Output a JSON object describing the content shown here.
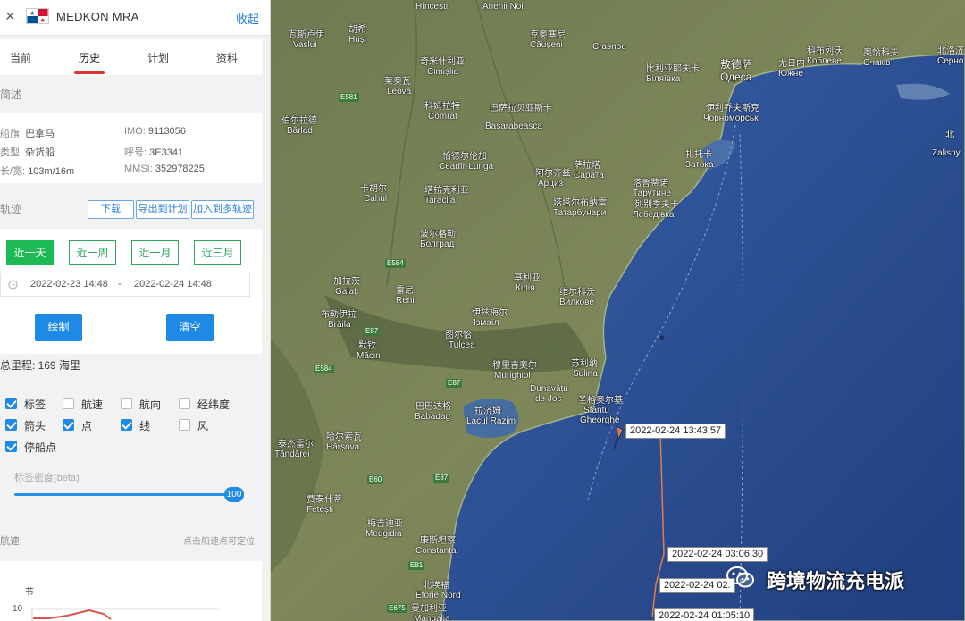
{
  "header": {
    "close_symbol": "×",
    "ship_name": "MEDKON MRA",
    "collapse_label": "收起",
    "flag_colors": [
      "#ffffff",
      "#d21034",
      "#005293"
    ]
  },
  "tabs": [
    {
      "label": "当前",
      "active": false
    },
    {
      "label": "历史",
      "active": true
    },
    {
      "label": "计划",
      "active": false
    },
    {
      "label": "资料",
      "active": false
    }
  ],
  "sections": {
    "basic": "简述",
    "track": "轨迹",
    "speed": "航速"
  },
  "basic_info": {
    "flag_key": "船旗:",
    "flag_value": "巴拿马",
    "type_key": "类型:",
    "type_value": "杂货船",
    "size_key": "长/宽:",
    "size_value": "103m/16m",
    "imo_key": "IMO:",
    "imo_value": "9113056",
    "callsign_key": "呼号:",
    "callsign_value": "3E3341",
    "mmsi_key": "MMSI:",
    "mmsi_value": "352978225"
  },
  "track_actions": {
    "download": "下载",
    "export_plan": "导出到计划",
    "add_multi": "加入到多轨迹"
  },
  "ranges": [
    {
      "label": "近一天",
      "active": true
    },
    {
      "label": "近一周",
      "active": false
    },
    {
      "label": "近一月",
      "active": false
    },
    {
      "label": "近三月",
      "active": false
    }
  ],
  "date_range": {
    "start": "2022-02-23 14:48",
    "separator": "-",
    "end": "2022-02-24 14:48"
  },
  "actions": {
    "draw": "绘制",
    "clear": "清空"
  },
  "total_distance": "总里程: 169 海里",
  "options": [
    {
      "label": "标签",
      "checked": true
    },
    {
      "label": "航速",
      "checked": false
    },
    {
      "label": "航向",
      "checked": false
    },
    {
      "label": "经纬度",
      "checked": false
    },
    {
      "label": "箭头",
      "checked": true
    },
    {
      "label": "点",
      "checked": true
    },
    {
      "label": "线",
      "checked": true
    },
    {
      "label": "风",
      "checked": false
    },
    {
      "label": "停船点",
      "checked": true
    }
  ],
  "label_density": {
    "label": "标签密度(beta)",
    "value": "100"
  },
  "speed_hint": "点击船速点可定位",
  "speed_chart": {
    "unit": "节",
    "y_tick": "10"
  },
  "map": {
    "places": [
      {
        "t": "Hîncești",
        "big": false
      },
      {
        "t": "Anenii Noi",
        "big": false
      },
      {
        "t": "瓦斯卢伊",
        "big": false
      },
      {
        "t": "Vaslui",
        "big": false
      },
      {
        "t": "胡希",
        "big": false
      },
      {
        "t": "Huși",
        "big": false
      },
      {
        "t": "奇米什利亚",
        "big": false
      },
      {
        "t": "Cimișlia",
        "big": false
      },
      {
        "t": "克奥塞尼",
        "big": false
      },
      {
        "t": "Căușeni",
        "big": false
      },
      {
        "t": "Crasnoe",
        "big": false
      },
      {
        "t": "比利亚耶夫卡",
        "big": false
      },
      {
        "t": "Біляївка",
        "big": false
      },
      {
        "t": "敖德萨",
        "big": true
      },
      {
        "t": "Одеса",
        "big": true
      },
      {
        "t": "尤日内",
        "big": false
      },
      {
        "t": "Южне",
        "big": false
      },
      {
        "t": "科布列沃",
        "big": false
      },
      {
        "t": "Коблеве",
        "big": false
      },
      {
        "t": "奥恰科夫",
        "big": false
      },
      {
        "t": "Очаків",
        "big": false
      },
      {
        "t": "北洛济",
        "big": false
      },
      {
        "t": "Сеpнo",
        "big": false
      },
      {
        "t": "莱奥瓦",
        "big": false
      },
      {
        "t": "Leova",
        "big": false
      },
      {
        "t": "科姆拉特",
        "big": false
      },
      {
        "t": "Comrat",
        "big": false
      },
      {
        "t": "巴萨拉贝亚斯卡",
        "big": false
      },
      {
        "t": "Basarabeasca",
        "big": false
      },
      {
        "t": "伊利乔夫斯克",
        "big": false
      },
      {
        "t": "Чорноморськ",
        "big": false
      },
      {
        "t": "伯尔拉德",
        "big": false
      },
      {
        "t": "Bârlad",
        "big": false
      },
      {
        "t": "恰德尔伦加",
        "big": false
      },
      {
        "t": "Ceadîr-Lunga",
        "big": false
      },
      {
        "t": "萨拉塔",
        "big": false
      },
      {
        "t": "Сарата",
        "big": false
      },
      {
        "t": "阿尔齐兹",
        "big": false
      },
      {
        "t": "Арциз",
        "big": false
      },
      {
        "t": "扎托卡",
        "big": false
      },
      {
        "t": "Затока",
        "big": false
      },
      {
        "t": "卡胡尔",
        "big": false
      },
      {
        "t": "Cahul",
        "big": false
      },
      {
        "t": "塔拉克利亚",
        "big": false
      },
      {
        "t": "Taraclia",
        "big": false
      },
      {
        "t": "塔鲁蒂诺",
        "big": false
      },
      {
        "t": "Тарутине",
        "big": false
      },
      {
        "t": "塔塔尔布纳雷",
        "big": false
      },
      {
        "t": "Татарбунари",
        "big": false
      },
      {
        "t": "列别季夫卡",
        "big": false
      },
      {
        "t": "Лебедівка",
        "big": false
      },
      {
        "t": "波尔格勒",
        "big": false
      },
      {
        "t": "Болград",
        "big": false
      },
      {
        "t": "加拉茨",
        "big": false
      },
      {
        "t": "Galați",
        "big": false
      },
      {
        "t": "雷尼",
        "big": false
      },
      {
        "t": "Reni",
        "big": false
      },
      {
        "t": "基利亚",
        "big": false
      },
      {
        "t": "Кілія",
        "big": false
      },
      {
        "t": "维尔科沃",
        "big": false
      },
      {
        "t": "Вилкове",
        "big": false
      },
      {
        "t": "布勒伊拉",
        "big": false
      },
      {
        "t": "Brăila",
        "big": false
      },
      {
        "t": "伊兹梅尔",
        "big": false
      },
      {
        "t": "Ізмаїл",
        "big": false
      },
      {
        "t": "默钦",
        "big": false
      },
      {
        "t": "Măcin",
        "big": false
      },
      {
        "t": "图尔恰",
        "big": false
      },
      {
        "t": "Tulcea",
        "big": false
      },
      {
        "t": "穆里吉奥尔",
        "big": false
      },
      {
        "t": "Murighiol",
        "big": false
      },
      {
        "t": "苏利纳",
        "big": false
      },
      {
        "t": "Sulina",
        "big": false
      },
      {
        "t": "Dunavățu",
        "big": false
      },
      {
        "t": "de Jos",
        "big": false
      },
      {
        "t": "巴巴达格",
        "big": false
      },
      {
        "t": "Babadag",
        "big": false
      },
      {
        "t": "拉济姆",
        "big": false
      },
      {
        "t": "Lacul Razim",
        "big": false
      },
      {
        "t": "圣格奥尔基",
        "big": false
      },
      {
        "t": "Sfântu",
        "big": false
      },
      {
        "t": "Gheorghe",
        "big": false
      },
      {
        "t": "哈尔索瓦",
        "big": false
      },
      {
        "t": "Hârșova",
        "big": false
      },
      {
        "t": "泰杰雷尔",
        "big": false
      },
      {
        "t": "Țăndărei",
        "big": false
      },
      {
        "t": "费泰什蒂",
        "big": false
      },
      {
        "t": "Fetești",
        "big": false
      },
      {
        "t": "梅吉迪亚",
        "big": false
      },
      {
        "t": "Medgidia",
        "big": false
      },
      {
        "t": "康斯坦察",
        "big": false
      },
      {
        "t": "Constanța",
        "big": false
      },
      {
        "t": "北埃福",
        "big": false
      },
      {
        "t": "Eforie Nord",
        "big": false
      },
      {
        "t": "曼加利亚",
        "big": false
      },
      {
        "t": "Mangalia",
        "big": false
      },
      {
        "t": "Zalisny",
        "big": false
      },
      {
        "t": "北",
        "big": false
      }
    ],
    "roads": [
      "E581",
      "E584",
      "E87",
      "E584",
      "E87",
      "E60",
      "E87",
      "E81",
      "E675"
    ],
    "track_labels": [
      "2022-02-24 13:43:57",
      "2022-02-24 03:06:30",
      "2022-02-24 02:",
      "2022-02-24 01:05:10"
    ],
    "track_color": "#e07b4a",
    "sea_color": "#2c4f8f"
  },
  "watermark": {
    "text": "跨境物流充电派"
  }
}
